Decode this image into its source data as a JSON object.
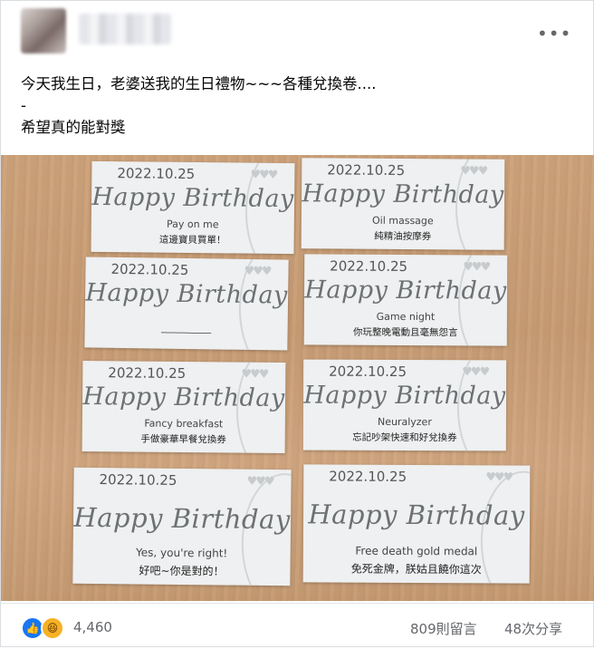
{
  "post": {
    "text_lines": [
      "今天我生日，老婆送我的生日禮物~~~各種兌換卷....",
      "-",
      "希望真的能對獎"
    ],
    "menu_icon": "more-horizontal-icon"
  },
  "cards": [
    {
      "date": "2022.10.25",
      "title": "Happy Birthday",
      "en": "Pay on me",
      "zh": "這邊寶貝買單！"
    },
    {
      "date": "2022.10.25",
      "title": "Happy Birthday",
      "en": "Oil massage",
      "zh": "純精油按摩券"
    },
    {
      "date": "2022.10.25",
      "title": "Happy Birthday",
      "en": "__________",
      "zh": ""
    },
    {
      "date": "2022.10.25",
      "title": "Happy Birthday",
      "en": "Game night",
      "zh": "你玩整晚電動且毫無怨言"
    },
    {
      "date": "2022.10.25",
      "title": "Happy Birthday",
      "en": "Fancy breakfast",
      "zh": "手做豪華早餐兌換券"
    },
    {
      "date": "2022.10.25",
      "title": "Happy Birthday",
      "en": "Neuralyzer",
      "zh": "忘記吵架快速和好兌換券"
    },
    {
      "date": "2022.10.25",
      "title": "Happy Birthday",
      "en": "Yes, you're right!",
      "zh": "好吧~你是對的！"
    },
    {
      "date": "2022.10.25",
      "title": "Happy Birthday",
      "en": "Free death gold medal",
      "zh": "免死金牌，朕姑且饒你這次"
    }
  ],
  "footer": {
    "reactions": [
      "like-icon",
      "haha-icon"
    ],
    "reaction_count": "4,460",
    "comments": "809則留言",
    "shares": "48次分享"
  }
}
